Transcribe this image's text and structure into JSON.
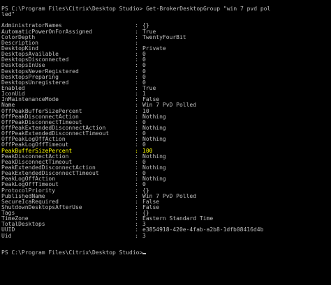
{
  "console": {
    "command_line_1": "PS C:\\Program Files\\Citrix\\Desktop Studio> Get-BrokerDesktopGroup \"win 7 pvd pol",
    "command_line_2": "led\"",
    "final_prompt": "PS C:\\Program Files\\Citrix\\Desktop Studio>",
    "separator": ":",
    "highlight_color": "#ffff00",
    "text_color": "#c0c0c0",
    "background_color": "#000000",
    "properties": [
      {
        "name": "AdministratorNames",
        "value": "{}"
      },
      {
        "name": "AutomaticPowerOnForAssigned",
        "value": "True"
      },
      {
        "name": "ColorDepth",
        "value": "TwentyFourBit"
      },
      {
        "name": "Description",
        "value": ""
      },
      {
        "name": "DesktopKind",
        "value": "Private"
      },
      {
        "name": "DesktopsAvailable",
        "value": "0"
      },
      {
        "name": "DesktopsDisconnected",
        "value": "0"
      },
      {
        "name": "DesktopsInUse",
        "value": "0"
      },
      {
        "name": "DesktopsNeverRegistered",
        "value": "0"
      },
      {
        "name": "DesktopsPreparing",
        "value": "0"
      },
      {
        "name": "DesktopsUnregistered",
        "value": "0"
      },
      {
        "name": "Enabled",
        "value": "True"
      },
      {
        "name": "IconUid",
        "value": "1"
      },
      {
        "name": "InMaintenanceMode",
        "value": "False"
      },
      {
        "name": "Name",
        "value": "Win 7 PvD Polled"
      },
      {
        "name": "OffPeakBufferSizePercent",
        "value": "10"
      },
      {
        "name": "OffPeakDisconnectAction",
        "value": "Nothing"
      },
      {
        "name": "OffPeakDisconnectTimeout",
        "value": "0"
      },
      {
        "name": "OffPeakExtendedDisconnectAction",
        "value": "Nothing"
      },
      {
        "name": "OffPeakExtendedDisconnectTimeout",
        "value": "0"
      },
      {
        "name": "OffPeakLogOffAction",
        "value": "Nothing"
      },
      {
        "name": "OffPeakLogOffTimeout",
        "value": "0"
      },
      {
        "name": "PeakBufferSizePercent",
        "value": "100",
        "highlight": true
      },
      {
        "name": "PeakDisconnectAction",
        "value": "Nothing"
      },
      {
        "name": "PeakDisconnectTimeout",
        "value": "0"
      },
      {
        "name": "PeakExtendedDisconnectAction",
        "value": "Nothing"
      },
      {
        "name": "PeakExtendedDisconnectTimeout",
        "value": "0"
      },
      {
        "name": "PeakLogOffAction",
        "value": "Nothing"
      },
      {
        "name": "PeakLogOffTimeout",
        "value": "0"
      },
      {
        "name": "ProtocolPriority",
        "value": "{}"
      },
      {
        "name": "PublishedName",
        "value": "Win 7 PvD Polled"
      },
      {
        "name": "SecureIcaRequired",
        "value": "False"
      },
      {
        "name": "ShutdownDesktopsAfterUse",
        "value": "False"
      },
      {
        "name": "Tags",
        "value": "{}"
      },
      {
        "name": "TimeZone",
        "value": "Eastern Standard Time"
      },
      {
        "name": "TotalDesktops",
        "value": "3"
      },
      {
        "name": "UUID",
        "value": "e3854918-420e-4fab-a2b8-1dfb08416d4b"
      },
      {
        "name": "Uid",
        "value": "3"
      }
    ]
  }
}
